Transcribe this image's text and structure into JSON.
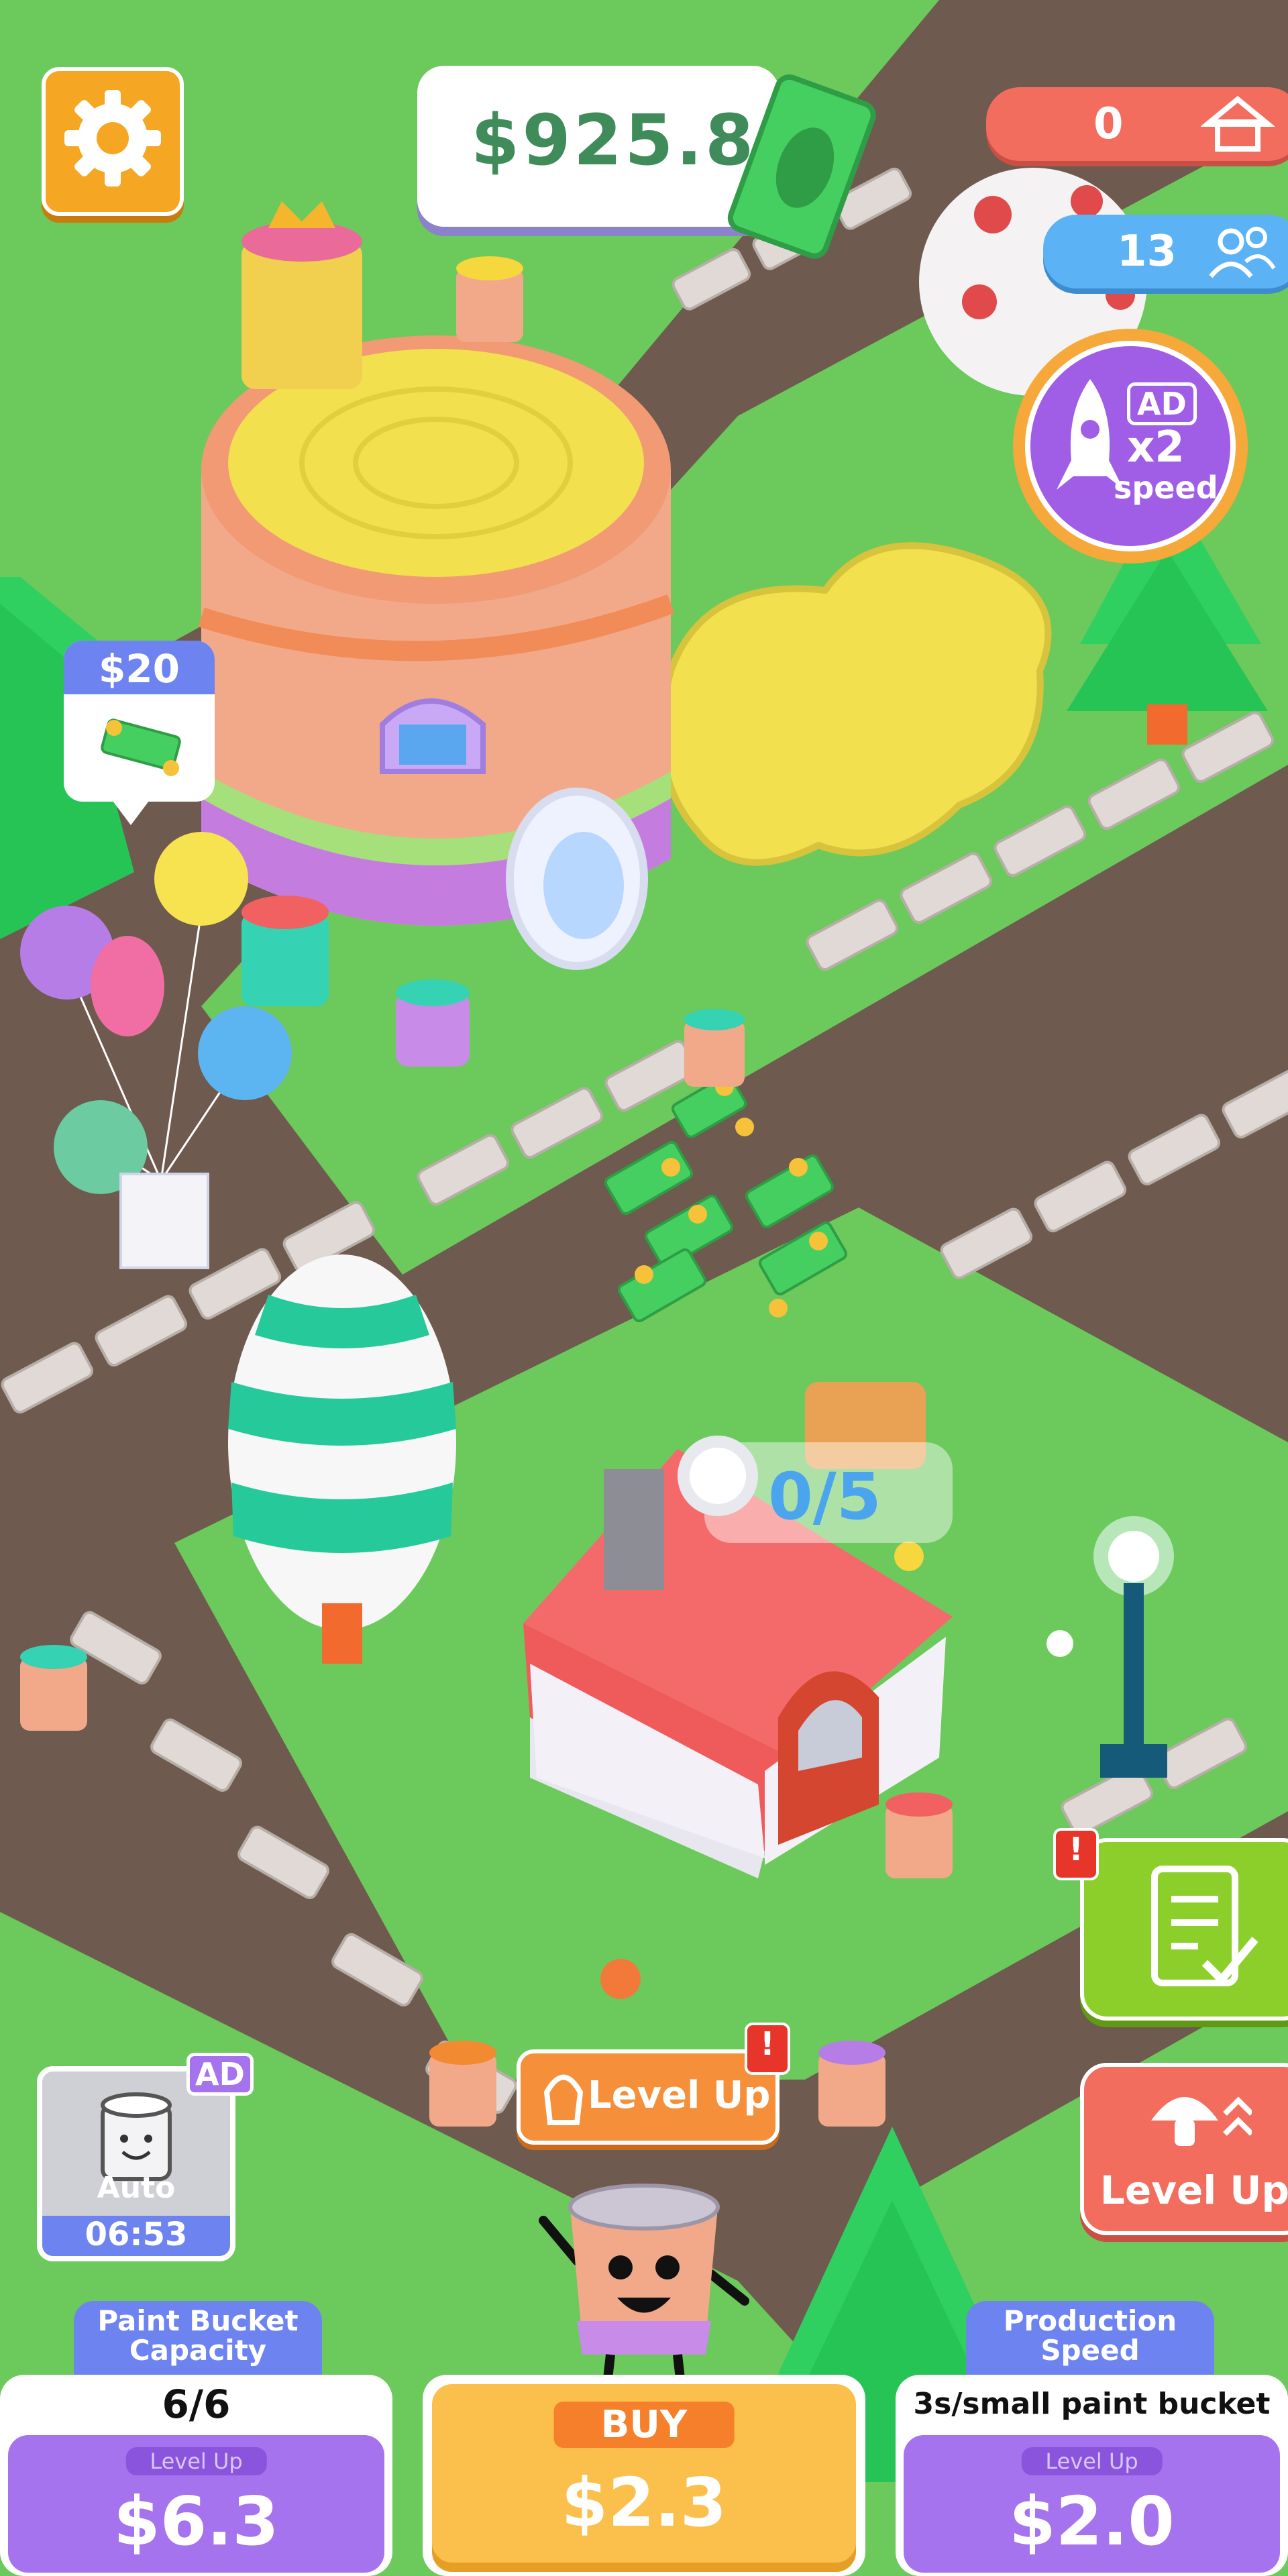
{
  "hud": {
    "money": "$925.8",
    "houses_count": "0",
    "workers_count": "13",
    "ad_speed": {
      "ad": "AD",
      "multiplier": "x2",
      "label": "speed"
    }
  },
  "map": {
    "price_tag": "$20",
    "house_progress": "0/5"
  },
  "side_buttons": {
    "level_up_label": "Level Up",
    "level_up_center_label": "Level Up",
    "alert_mark": "!"
  },
  "auto": {
    "ad": "AD",
    "label": "Auto",
    "timer": "06:53"
  },
  "bottom": {
    "capacity": {
      "title": "Paint Bucket Capacity",
      "value": "6/6",
      "level_up": "Level Up",
      "price": "$6.3"
    },
    "buy": {
      "label": "BUY",
      "price": "$2.3"
    },
    "speed": {
      "title": "Production Speed",
      "value": "3s/small paint bucket",
      "level_up": "Level Up",
      "price": "$2.0"
    }
  },
  "colors": {
    "grass": "#6cc95c",
    "road": "#6e5a4e",
    "accent_orange": "#f5a623",
    "accent_purple": "#a573ee",
    "accent_green": "#8ccf2b",
    "accent_red": "#f36d5e",
    "accent_blue": "#6d84f0",
    "money_green": "#3f8c5a"
  },
  "icons": [
    "gear-icon",
    "cash-icon",
    "house-icon",
    "people-icon",
    "rocket-icon",
    "checklist-icon",
    "mushroom-icon",
    "paint-bucket-icon"
  ]
}
